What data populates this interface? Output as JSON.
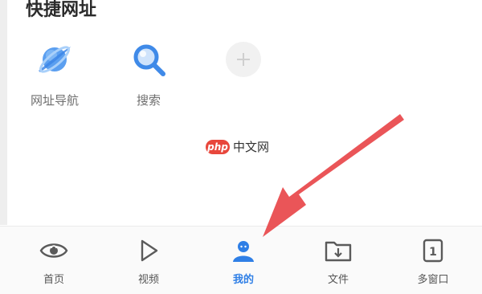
{
  "quick_links": {
    "title": "快捷网址",
    "items": [
      {
        "label": "网址导航",
        "icon": "planet-icon"
      },
      {
        "label": "搜索",
        "icon": "search-icon"
      },
      {
        "label": "",
        "icon": "add-icon"
      }
    ]
  },
  "watermark": {
    "logo": "php",
    "text": "中文网"
  },
  "tabbar": {
    "items": [
      {
        "label": "首页",
        "icon": "eye-icon"
      },
      {
        "label": "视频",
        "icon": "play-icon"
      },
      {
        "label": "我的",
        "icon": "user-icon",
        "active": true
      },
      {
        "label": "文件",
        "icon": "folder-icon"
      },
      {
        "label": "多窗口",
        "icon": "window-count-icon",
        "badge": "1"
      }
    ]
  },
  "colors": {
    "accent": "#2f7fe6",
    "arrow": "#e8474a"
  }
}
